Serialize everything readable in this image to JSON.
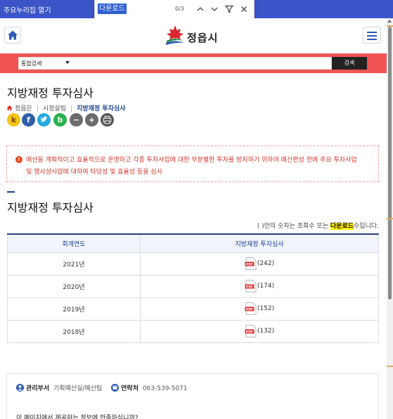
{
  "browser": {
    "top_label": "주요누리집 열기",
    "find": {
      "query": "다운로드",
      "count": "0/3"
    }
  },
  "header": {
    "logo_text": "정읍시"
  },
  "search": {
    "scope": "통합검색",
    "placeholder": "",
    "button": "검색"
  },
  "page": {
    "title": "지방재정 투자심사",
    "breadcrumb": [
      "정읍은",
      "시정살림",
      "지방재정 투자심사"
    ]
  },
  "share": [
    {
      "label": "k",
      "icon": "kakaostory-icon",
      "color": "#f5c518"
    },
    {
      "label": "f",
      "icon": "facebook-icon",
      "color": "#2f5fa8"
    },
    {
      "label": "t",
      "icon": "twitter-icon",
      "color": "#25a8e0"
    },
    {
      "label": "b",
      "icon": "band-icon",
      "color": "#2bb24c"
    },
    {
      "label": "−",
      "icon": "zoom-out-icon",
      "color": "#6b6b6b"
    },
    {
      "label": "+",
      "icon": "zoom-in-icon",
      "color": "#6b6b6b"
    },
    {
      "label": "",
      "icon": "print-icon",
      "color": "#555555"
    }
  ],
  "notice": {
    "line1": "예산을 계획적이고 효율적으로 운영하고 각종 투자사업에 대한 무분별한 투자를 방지하기 위하여 예산편성 전에 주요 투자사업",
    "line2": "및 행사성사업에 대하여 타당성 및 효율성 등을 심사"
  },
  "section": {
    "title": "지방재정 투자심사",
    "note_prefix": "( )안의 숫자는 조회수 또는 ",
    "note_highlight": "다운로드",
    "note_suffix": "수입니다."
  },
  "table": {
    "headers": [
      "회계연도",
      "지방재정 투자심사"
    ],
    "rows": [
      {
        "year": "2021년",
        "count": "(242)"
      },
      {
        "year": "2020년",
        "count": "(174)"
      },
      {
        "year": "2019년",
        "count": "(152)"
      },
      {
        "year": "2018년",
        "count": "(132)"
      }
    ]
  },
  "footer": {
    "dept_label": "관리부서",
    "dept_value": "기획예산실/예산팀",
    "contact_label": "연락처",
    "contact_value": "063-539-5071",
    "survey": "이 페이지에서 제공하는 정보에 만족하십니까?"
  },
  "colors": {
    "accent": "#1b3f91",
    "search_band": "#f05454",
    "notice_text": "#d0352b",
    "highlight": "#ffee00"
  }
}
